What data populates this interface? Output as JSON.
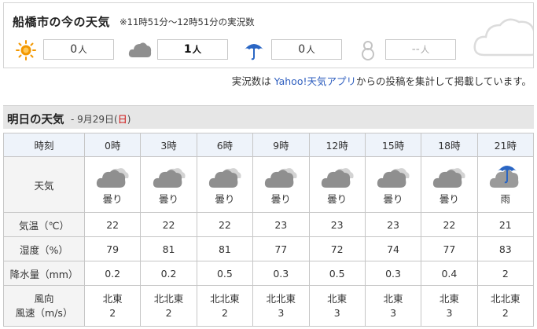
{
  "report": {
    "title": "船橋市の今の天気",
    "note": "※11時51分～12時51分の実況数",
    "items": [
      {
        "icon": "sun-icon",
        "count": "0",
        "unit": "人",
        "style": "normal"
      },
      {
        "icon": "cloud-icon",
        "count": "1",
        "unit": "人",
        "style": "bold"
      },
      {
        "icon": "umbrella-icon",
        "count": "0",
        "unit": "人",
        "style": "normal"
      },
      {
        "icon": "snowman-icon",
        "count": "--",
        "unit": "人",
        "style": "muted"
      }
    ],
    "credit_prefix": "実況数は ",
    "credit_link": "Yahoo!天気アプリ",
    "credit_suffix": "からの投稿を集計して掲載しています。"
  },
  "tomorrow": {
    "title": "明日の天気",
    "date_prefix": "- 9月29日(",
    "date_weekday": "日",
    "date_suffix": ")"
  },
  "forecast": {
    "labels": {
      "time": "時刻",
      "weather": "天気",
      "temp": "気温（℃）",
      "humidity": "湿度（%）",
      "precip": "降水量（mm）",
      "wind_dir": "風向",
      "wind_speed": "風速（m/s）"
    },
    "columns": [
      {
        "time": "0時",
        "icon": "cloud-icon",
        "weather": "曇り",
        "temp": "22",
        "humidity": "79",
        "precip": "0.2",
        "wind_dir": "北東",
        "wind_speed": "2"
      },
      {
        "time": "3時",
        "icon": "cloud-icon",
        "weather": "曇り",
        "temp": "22",
        "humidity": "81",
        "precip": "0.2",
        "wind_dir": "北北東",
        "wind_speed": "2"
      },
      {
        "time": "6時",
        "icon": "cloud-icon",
        "weather": "曇り",
        "temp": "22",
        "humidity": "81",
        "precip": "0.5",
        "wind_dir": "北北東",
        "wind_speed": "2"
      },
      {
        "time": "9時",
        "icon": "cloud-icon",
        "weather": "曇り",
        "temp": "23",
        "humidity": "77",
        "precip": "0.3",
        "wind_dir": "北北東",
        "wind_speed": "3"
      },
      {
        "time": "12時",
        "icon": "cloud-icon",
        "weather": "曇り",
        "temp": "23",
        "humidity": "72",
        "precip": "0.5",
        "wind_dir": "北東",
        "wind_speed": "3"
      },
      {
        "time": "15時",
        "icon": "cloud-icon",
        "weather": "曇り",
        "temp": "23",
        "humidity": "74",
        "precip": "0.3",
        "wind_dir": "北東",
        "wind_speed": "3"
      },
      {
        "time": "18時",
        "icon": "cloud-icon",
        "weather": "曇り",
        "temp": "22",
        "humidity": "77",
        "precip": "0.4",
        "wind_dir": "北東",
        "wind_speed": "3"
      },
      {
        "time": "21時",
        "icon": "rain-icon",
        "weather": "雨",
        "temp": "21",
        "humidity": "83",
        "precip": "2",
        "wind_dir": "北北東",
        "wind_speed": "2"
      }
    ]
  },
  "colors": {
    "link": "#2f5fbf",
    "sunday": "#cc0000",
    "sun": "#f39800",
    "cloud": "#8f8f8f",
    "umbrella": "#2a66c4"
  }
}
